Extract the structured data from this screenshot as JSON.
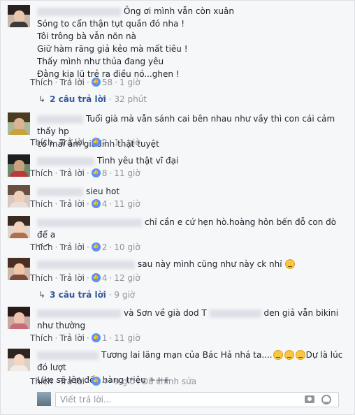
{
  "colors": {
    "link": "#365899",
    "meta": "#90949c",
    "like": "#5890ff"
  },
  "comments": [
    {
      "name": "Nguyễn Văn",
      "lines": [
        "Ông ơi mình vẫn còn xuân",
        "Sóng to cẩn thận tụt quần đó nha !",
        "Tôi trông bà vẫn nõn nà",
        "Giữ hàm răng giả kẻo mà mất tiêu !",
        "Thấy mình như thủa đang yêu",
        "Đằng kia lũ trẻ ra điều nó...ghen !"
      ],
      "like_label": "Thích",
      "reply_label": "Trả lời",
      "likes": "58",
      "time": "1 giờ",
      "replies": {
        "count": "2 câu trả lời",
        "time": "32 phút"
      }
    },
    {
      "name": "Hoàng Tuấn",
      "lines": [
        "Tuổi già mà vẫn sánh cai bên nhau như vầy thì con cái cảm thấy hp",
        "có mái ấm giadinh thật tuyệt"
      ],
      "like_label": "Thích",
      "reply_label": "Trả lời",
      "likes": "2",
      "time": "11 giờ"
    },
    {
      "name": "Trần Minh",
      "lines": [
        "Tình yêu thật vĩ đại"
      ],
      "like_label": "Thích",
      "reply_label": "Trả lời",
      "likes": "8",
      "time": "11 giờ"
    },
    {
      "name": "Lê Huyền",
      "lines": [
        "sieu hot"
      ],
      "like_label": "Thích",
      "reply_label": "Trả lời",
      "likes": "4",
      "time": "11 giờ"
    },
    {
      "name": "Ngọc Anh Nguyễn",
      "lines": [
        "chỉ cần e cứ hẹn hò.hoàng hôn bến đỗ con đò để a",
        "^^"
      ],
      "like_label": "Thích",
      "reply_label": "Trả lời",
      "likes": "2",
      "time": "10 giờ"
    },
    {
      "name": "Phạm Thảo",
      "lines": [
        "sau này mình cũng như này ck nhỉ"
      ],
      "like_label": "Thích",
      "reply_label": "Trả lời",
      "likes": "4",
      "time": "12 giờ",
      "replies": {
        "count": "3 câu trả lời",
        "time": "9 giờ"
      }
    },
    {
      "name": "Trâm Lê",
      "lines": [
        "và Sơn về già dod T",
        "den giả vẫn bikini",
        "như thường"
      ],
      "like_label": "Thích",
      "reply_label": "Trả lời",
      "likes": "1",
      "time": "11 giờ"
    },
    {
      "name": "Hà My",
      "lines": [
        "Tương lai lãng mạn của Bác Hả nhá ta....",
        "Dự là lúc đó lượt",
        "Like sẽ lên đến hàng triệu +++"
      ],
      "like_label": "Thích",
      "reply_label": "Trả lời",
      "likes": "4",
      "time": "9 giờ",
      "edited": "Đã chỉnh sửa"
    }
  ],
  "reply_box": {
    "placeholder": "Viết trả lời..."
  },
  "icons": [
    "camera-icon",
    "smiley-icon",
    "like-icon",
    "reply-arrow-icon"
  ]
}
